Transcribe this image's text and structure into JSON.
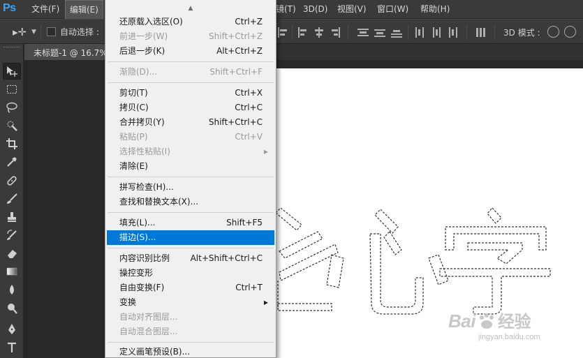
{
  "app": {
    "logo": "Ps"
  },
  "menubar": {
    "items": [
      {
        "label": "文件(F)"
      },
      {
        "label": "编辑(E)"
      },
      {
        "label": "镜(T)"
      },
      {
        "label": "3D(D)"
      },
      {
        "label": "视图(V)"
      },
      {
        "label": "窗口(W)"
      },
      {
        "label": "帮助(H)"
      }
    ]
  },
  "options_bar": {
    "auto_select_label": "自动选择 :",
    "auto_select_checked": false,
    "mode_label": "3D 模式 :"
  },
  "document": {
    "tab_title": "未标题-1 @ 16.7%"
  },
  "edit_menu": {
    "items": [
      {
        "label": "还原载入选区(O)",
        "shortcut": "Ctrl+Z",
        "disabled": false
      },
      {
        "label": "前进一步(W)",
        "shortcut": "Shift+Ctrl+Z",
        "disabled": true
      },
      {
        "label": "后退一步(K)",
        "shortcut": "Alt+Ctrl+Z",
        "disabled": false
      },
      {
        "label": "渐隐(D)...",
        "shortcut": "Shift+Ctrl+F",
        "disabled": true
      },
      {
        "label": "剪切(T)",
        "shortcut": "Ctrl+X",
        "disabled": false
      },
      {
        "label": "拷贝(C)",
        "shortcut": "Ctrl+C",
        "disabled": false
      },
      {
        "label": "合并拷贝(Y)",
        "shortcut": "Shift+Ctrl+C",
        "disabled": false
      },
      {
        "label": "粘贴(P)",
        "shortcut": "Ctrl+V",
        "disabled": true
      },
      {
        "label": "选择性粘贴(I)",
        "shortcut": "",
        "disabled": true,
        "submenu": true
      },
      {
        "label": "清除(E)",
        "shortcut": "",
        "disabled": false
      },
      {
        "label": "拼写检查(H)...",
        "shortcut": "",
        "disabled": false
      },
      {
        "label": "查找和替换文本(X)...",
        "shortcut": "",
        "disabled": false
      },
      {
        "label": "填充(L)...",
        "shortcut": "Shift+F5",
        "disabled": false
      },
      {
        "label": "描边(S)...",
        "shortcut": "",
        "disabled": false,
        "selected": true
      },
      {
        "label": "内容识别比例",
        "shortcut": "Alt+Shift+Ctrl+C",
        "disabled": false
      },
      {
        "label": "操控变形",
        "shortcut": "",
        "disabled": false
      },
      {
        "label": "自由变换(F)",
        "shortcut": "Ctrl+T",
        "disabled": false
      },
      {
        "label": "变换",
        "shortcut": "",
        "disabled": false,
        "submenu": true
      },
      {
        "label": "自动对齐图层...",
        "shortcut": "",
        "disabled": true
      },
      {
        "label": "自动混合图层...",
        "shortcut": "",
        "disabled": true
      },
      {
        "label": "定义画笔预设(B)...",
        "shortcut": "",
        "disabled": false
      }
    ]
  },
  "watermark": {
    "brand": "Bai",
    "brand_cn": "经验",
    "url": "jingyan.baidu.com"
  },
  "colors": {
    "selected_highlight": "#0078d7",
    "ui_dark": "#3a3a3a",
    "logo_blue": "#31a8ff"
  }
}
